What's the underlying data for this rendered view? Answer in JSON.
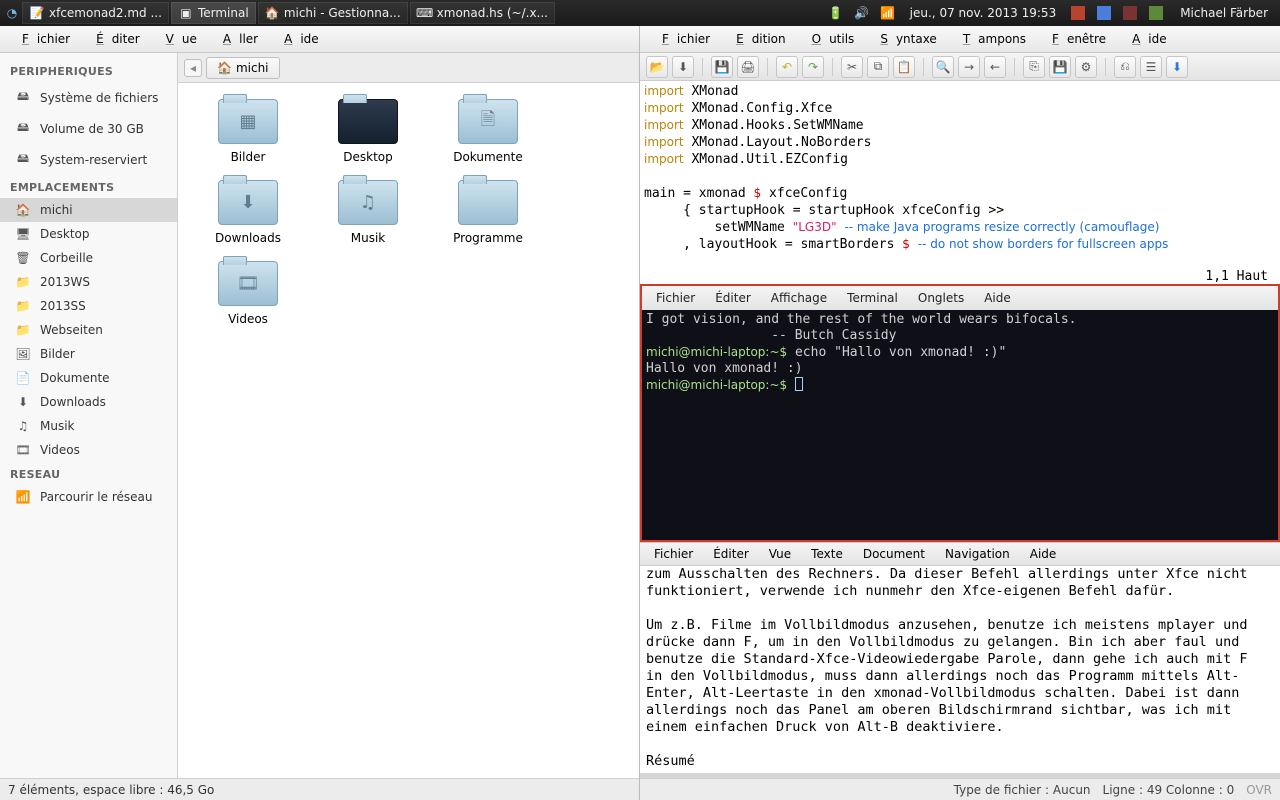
{
  "panel": {
    "tasks": [
      {
        "icon": "📝",
        "label": "xfcemonad2.md ..."
      },
      {
        "icon": "▣",
        "label": "Terminal",
        "active": true
      },
      {
        "icon": "🏠",
        "label": "michi - Gestionna..."
      },
      {
        "icon": "⌨",
        "label": "xmonad.hs (~/.x..."
      }
    ],
    "clock": "jeu., 07 nov. 2013 19:53",
    "user": "Michael Färber"
  },
  "fm": {
    "menus": [
      "Fichier",
      "Éditer",
      "Vue",
      "Aller",
      "Aide"
    ],
    "sidebar": {
      "groups": [
        {
          "title": "PERIPHERIQUES",
          "items": [
            {
              "icon": "🖴",
              "label": "Système de fichiers"
            },
            {
              "icon": "🖴",
              "label": "Volume de 30 GB"
            },
            {
              "icon": "🖴",
              "label": "System-reserviert"
            }
          ]
        },
        {
          "title": "EMPLACEMENTS",
          "items": [
            {
              "icon": "🏠",
              "label": "michi",
              "selected": true
            },
            {
              "icon": "🖥",
              "label": "Desktop"
            },
            {
              "icon": "🗑",
              "label": "Corbeille"
            },
            {
              "icon": "📁",
              "label": "2013WS"
            },
            {
              "icon": "📁",
              "label": "2013SS"
            },
            {
              "icon": "📁",
              "label": "Webseiten"
            },
            {
              "icon": "🖼",
              "label": "Bilder"
            },
            {
              "icon": "📄",
              "label": "Dokumente"
            },
            {
              "icon": "⬇",
              "label": "Downloads"
            },
            {
              "icon": "♫",
              "label": "Musik"
            },
            {
              "icon": "🎞",
              "label": "Videos"
            }
          ]
        },
        {
          "title": "RESEAU",
          "items": [
            {
              "icon": "📶",
              "label": "Parcourir le réseau"
            }
          ]
        }
      ]
    },
    "path": {
      "label": "michi"
    },
    "folders": [
      {
        "label": "Bilder",
        "glyph": "▦"
      },
      {
        "label": "Desktop",
        "glyph": "",
        "desktop": true
      },
      {
        "label": "Dokumente",
        "glyph": "🗎"
      },
      {
        "label": "",
        "glyph": ""
      },
      {
        "label": "Downloads",
        "glyph": "⬇"
      },
      {
        "label": "Musik",
        "glyph": "♫"
      },
      {
        "label": "Programme",
        "glyph": ""
      },
      {
        "label": "",
        "glyph": ""
      },
      {
        "label": "Videos",
        "glyph": "🎞"
      }
    ],
    "status": "7 éléments, espace libre : 46,5 Go"
  },
  "editor": {
    "menus": [
      "Fichier",
      "Edition",
      "Outils",
      "Syntaxe",
      "Tampons",
      "Fenêtre",
      "Aide"
    ],
    "code_lines": [
      [
        {
          "t": "import",
          "c": "kw"
        },
        {
          "t": " XMonad"
        }
      ],
      [
        {
          "t": "import",
          "c": "kw"
        },
        {
          "t": " XMonad.Config.Xfce"
        }
      ],
      [
        {
          "t": "import",
          "c": "kw"
        },
        {
          "t": " XMonad.Hooks.SetWMName"
        }
      ],
      [
        {
          "t": "import",
          "c": "kw"
        },
        {
          "t": " XMonad.Layout.NoBorders"
        }
      ],
      [
        {
          "t": "import",
          "c": "kw"
        },
        {
          "t": " XMonad.Util.EZConfig"
        }
      ],
      [
        {
          "t": ""
        }
      ],
      [
        {
          "t": "main = xmonad "
        },
        {
          "t": "$",
          "c": "err"
        },
        {
          "t": " xfceConfig"
        }
      ],
      [
        {
          "t": "     { startupHook = startupHook xfceConfig >>"
        }
      ],
      [
        {
          "t": "         setWMName "
        },
        {
          "t": "\"LG3D\"",
          "c": "str"
        },
        {
          "t": " "
        },
        {
          "t": "-- make Java programs resize correctly (camouflage)",
          "c": "cm"
        }
      ],
      [
        {
          "t": "     , layoutHook = smartBorders "
        },
        {
          "t": "$",
          "c": "err"
        },
        {
          "t": " "
        },
        {
          "t": "-- do not show borders for fullscreen apps",
          "c": "cm"
        }
      ]
    ],
    "status": "1,1           Haut"
  },
  "terminal": {
    "menus": [
      "Fichier",
      "Éditer",
      "Affichage",
      "Terminal",
      "Onglets",
      "Aide"
    ],
    "lines": [
      "I got vision, and the rest of the world wears bifocals.",
      "                -- Butch Cassidy",
      {
        "prompt": "michi@michi-laptop:~$",
        "cmd": " echo \"Hallo von xmonad! :)\""
      },
      "Hallo von xmonad! :)",
      {
        "prompt": "michi@michi-laptop:~$",
        "cmd": " ",
        "cursor": true
      }
    ]
  },
  "doc": {
    "menus": [
      "Fichier",
      "Éditer",
      "Vue",
      "Texte",
      "Document",
      "Navigation",
      "Aide"
    ],
    "body": "zum Ausschalten des Rechners. Da dieser Befehl allerdings unter Xfce nicht\nfunktioniert, verwende ich nunmehr den Xfce-eigenen Befehl dafür.\n\nUm z.B. Filme im Vollbildmodus anzusehen, benutze ich meistens mplayer und\ndrücke dann F, um in den Vollbildmodus zu gelangen. Bin ich aber faul und\nbenutze die Standard-Xfce-Videowiedergabe Parole, dann gehe ich auch mit F\nin den Vollbildmodus, muss dann allerdings noch das Programm mittels Alt-\nEnter, Alt-Leertaste in den xmonad-Vollbildmodus schalten. Dabei ist dann\nallerdings noch das Panel am oberen Bildschirmrand sichtbar, was ich mit\neinem einfachen Druck von Alt-B deaktiviere.\n\nRésumé",
    "status": {
      "type": "Type de fichier : Aucun",
      "pos": "Ligne : 49 Colonne : 0",
      "ovr": "OVR"
    }
  }
}
